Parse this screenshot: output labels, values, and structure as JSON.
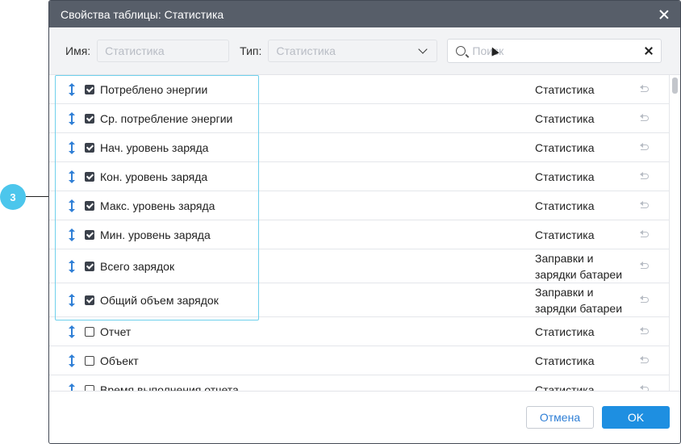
{
  "annotation": {
    "badge": "3"
  },
  "dialog": {
    "title": "Свойства таблицы: Статистика",
    "filters": {
      "name_label": "Имя:",
      "name_value": "Статистика",
      "type_label": "Тип:",
      "type_value": "Статистика",
      "search_placeholder": "Поиск"
    },
    "rows": [
      {
        "label": "Потреблено энергии",
        "checked": true,
        "type": "Статистика"
      },
      {
        "label": "Ср. потребление энергии",
        "checked": true,
        "type": "Статистика"
      },
      {
        "label": "Нач. уровень заряда",
        "checked": true,
        "type": "Статистика"
      },
      {
        "label": "Кон. уровень заряда",
        "checked": true,
        "type": "Статистика"
      },
      {
        "label": "Макс. уровень заряда",
        "checked": true,
        "type": "Статистика"
      },
      {
        "label": "Мин. уровень заряда",
        "checked": true,
        "type": "Статистика"
      },
      {
        "label": "Всего зарядок",
        "checked": true,
        "type": "Заправки и зарядки батареи"
      },
      {
        "label": "Общий объем зарядок",
        "checked": true,
        "type": "Заправки и зарядки батареи"
      },
      {
        "label": "Отчет",
        "checked": false,
        "type": "Статистика"
      },
      {
        "label": "Объект",
        "checked": false,
        "type": "Статистика"
      },
      {
        "label": "Время выполнения отчета",
        "checked": false,
        "type": "Статистика"
      }
    ],
    "footer": {
      "cancel_label": "Отмена",
      "ok_label": "OK"
    }
  },
  "colors": {
    "accent": "#1e8fe1",
    "highlight": "#6fd0ec",
    "titlebar": "#575e69"
  }
}
